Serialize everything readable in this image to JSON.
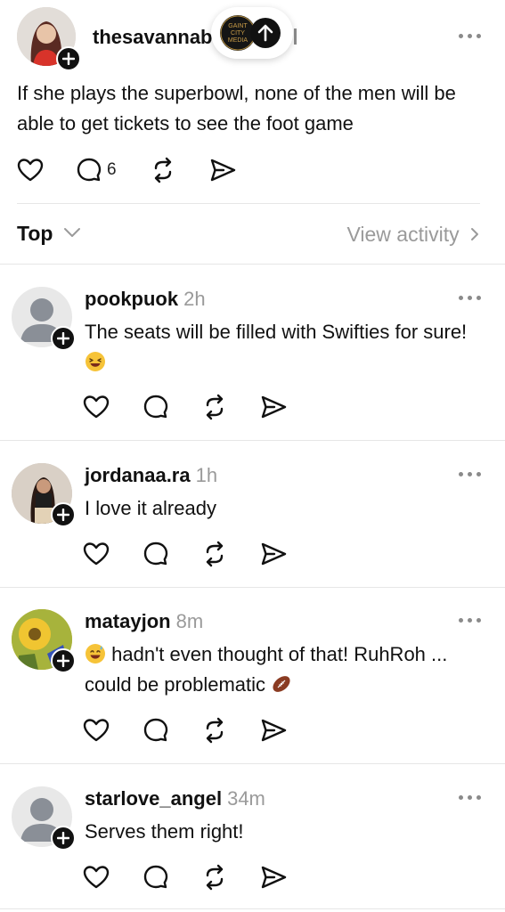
{
  "post": {
    "username": "thesavannab",
    "text": "If she plays the superbowl, none of the men will be able to get tickets to see the foot game",
    "reply_count": "6",
    "overlay_logo_text": "GAINT CITY MEDIA"
  },
  "sort_bar": {
    "sort_label": "Top",
    "view_activity_label": "View activity"
  },
  "replies": [
    {
      "username": "pookpuok",
      "time": "2h",
      "text": "The seats will be filled with Swifties for sure!"
    },
    {
      "username": "jordanaa.ra",
      "time": "1h",
      "text": "I love it already"
    },
    {
      "username": "matayjon",
      "time": "8m",
      "text_part1": "hadn't even thought of that!  RuhRoh ...",
      "text_part2": "could be problematic"
    },
    {
      "username": "starlove_angel",
      "time": "34m",
      "text": "Serves them right!"
    }
  ],
  "icons": {
    "like": "heart-icon",
    "reply": "comment-icon",
    "repost": "repost-icon",
    "share": "send-icon",
    "more": "more-icon",
    "follow": "plus-icon",
    "scroll_up": "arrow-up-icon"
  }
}
